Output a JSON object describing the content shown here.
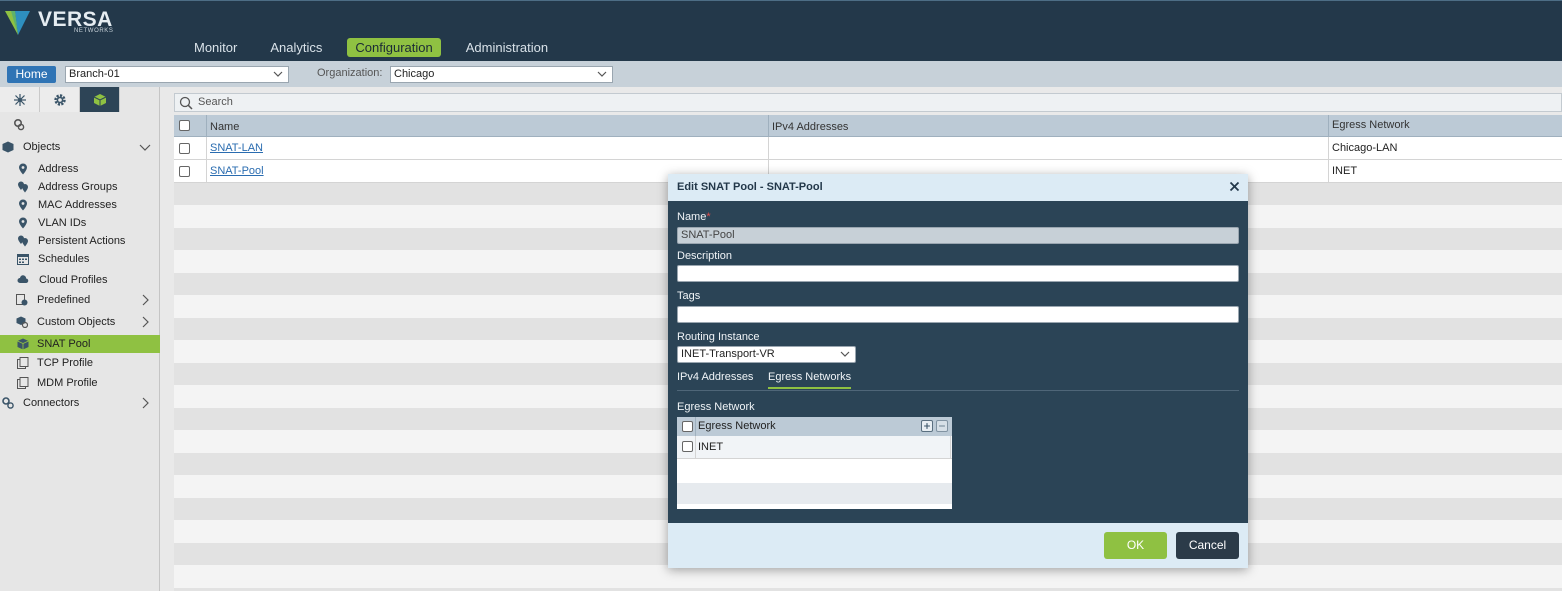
{
  "brand": {
    "name": "VERSA",
    "sub": "NETWORKS",
    "accent": "#8fc142",
    "header_bg": "#23384a"
  },
  "nav": [
    {
      "label": "Monitor",
      "active": false
    },
    {
      "label": "Analytics",
      "active": false
    },
    {
      "label": "Configuration",
      "active": true
    },
    {
      "label": "Administration",
      "active": false
    }
  ],
  "context": {
    "home_label": "Home",
    "appliance": "Branch-01",
    "org_label": "Organization:",
    "organization": "Chicago"
  },
  "sidebar": {
    "tabs": [
      "network-icon",
      "gear-icon",
      "objects-icon"
    ],
    "items": [
      {
        "label": "Objects",
        "icon": "objects-icon"
      },
      {
        "label": "Address",
        "icon": "pin-icon"
      },
      {
        "label": "Address Groups",
        "icon": "pin-group-icon"
      },
      {
        "label": "MAC Addresses",
        "icon": "pin-icon"
      },
      {
        "label": "VLAN IDs",
        "icon": "pin-icon"
      },
      {
        "label": "Persistent Actions",
        "icon": "pin-group-icon"
      },
      {
        "label": "Schedules",
        "icon": "calendar-icon"
      },
      {
        "label": "Cloud Profiles",
        "icon": "cloud-icon"
      },
      {
        "label": "Predefined",
        "icon": "predefined-icon"
      },
      {
        "label": "Custom Objects",
        "icon": "custom-objects-icon"
      },
      {
        "label": "SNAT Pool",
        "icon": "snat-icon",
        "active": true
      },
      {
        "label": "TCP Profile",
        "icon": "profile-icon"
      },
      {
        "label": "MDM Profile",
        "icon": "profile-icon"
      },
      {
        "label": "Connectors",
        "icon": "connectors-icon"
      }
    ]
  },
  "search": {
    "placeholder": "Search"
  },
  "table": {
    "columns": [
      "Name",
      "IPv4 Addresses",
      "Egress Network"
    ],
    "rows": [
      {
        "name": "SNAT-LAN",
        "ipv4": "",
        "egress": "Chicago-LAN"
      },
      {
        "name": "SNAT-Pool",
        "ipv4": "",
        "egress": "INET"
      }
    ]
  },
  "modal": {
    "title": "Edit SNAT Pool - SNAT-Pool",
    "name_label": "Name",
    "required_mark": "*",
    "name_value": "SNAT-Pool",
    "description_label": "Description",
    "description_value": "",
    "tags_label": "Tags",
    "tags_value": "",
    "routing_label": "Routing Instance",
    "routing_value": "INET-Transport-VR",
    "tabs": [
      "IPv4 Addresses",
      "Egress Networks"
    ],
    "active_tab": "Egress Networks",
    "egress_section_label": "Egress Network",
    "egress_grid": {
      "column": "Egress Network",
      "rows": [
        "INET"
      ]
    },
    "ok_label": "OK",
    "cancel_label": "Cancel"
  }
}
